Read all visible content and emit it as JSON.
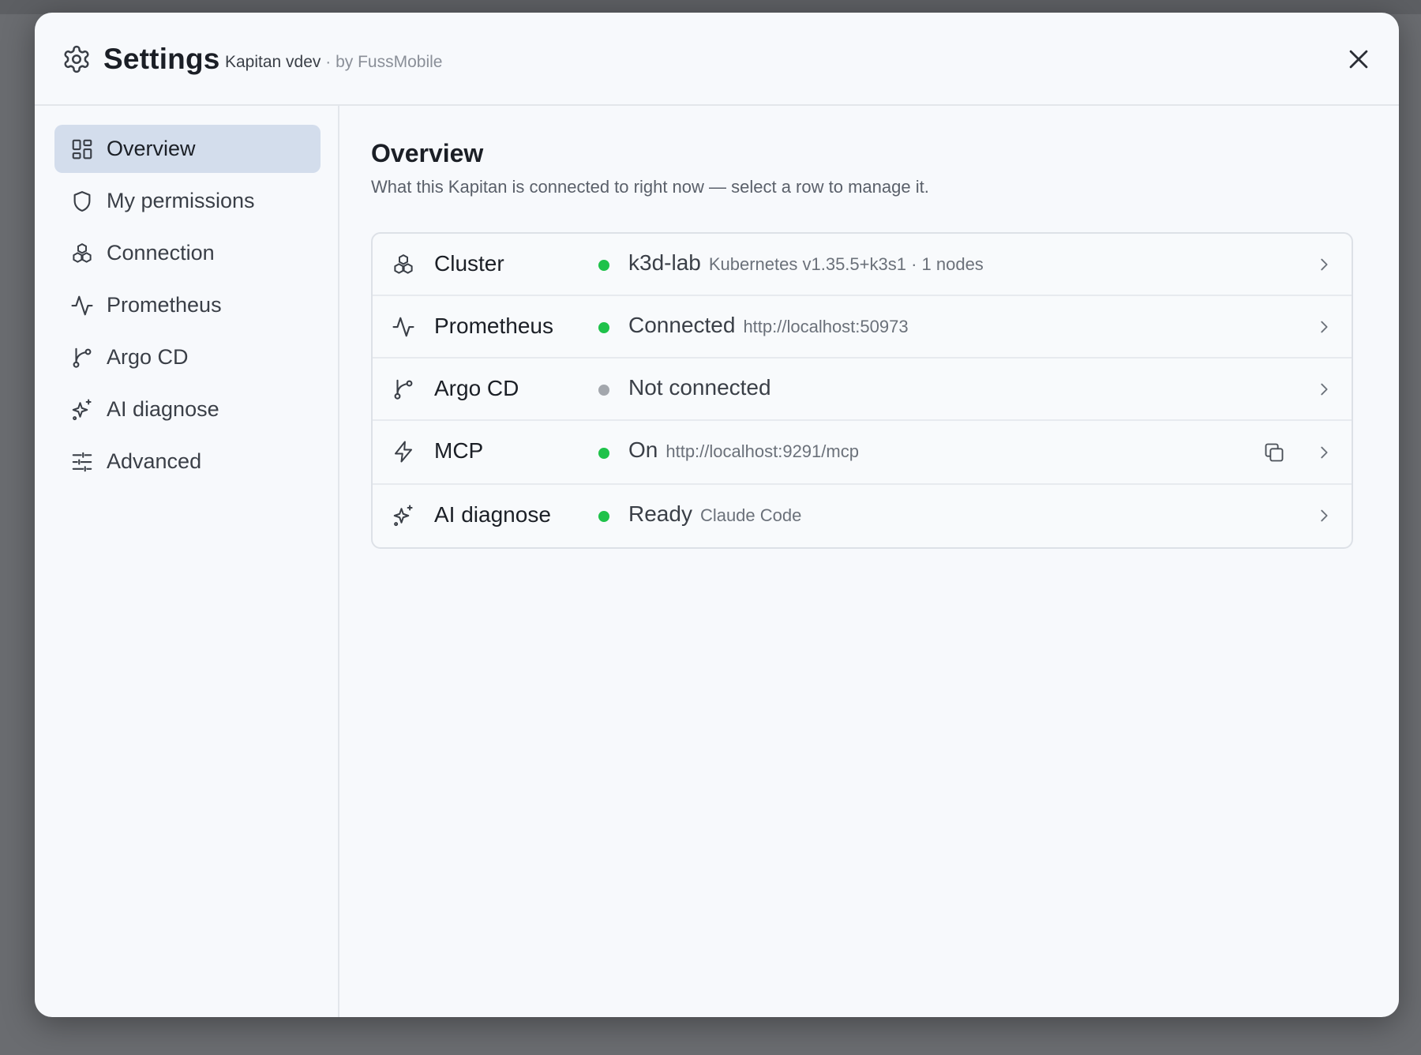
{
  "header": {
    "title": "Settings",
    "app_name": "Kapitan vdev",
    "by_line": "· by FussMobile"
  },
  "sidebar": {
    "items": [
      {
        "label": "Overview",
        "icon": "grid-icon",
        "active": true
      },
      {
        "label": "My permissions",
        "icon": "shield-icon"
      },
      {
        "label": "Connection",
        "icon": "cubes-icon"
      },
      {
        "label": "Prometheus",
        "icon": "pulse-icon"
      },
      {
        "label": "Argo CD",
        "icon": "git-branch-icon"
      },
      {
        "label": "AI diagnose",
        "icon": "sparkles-icon"
      },
      {
        "label": "Advanced",
        "icon": "sliders-icon"
      }
    ]
  },
  "main": {
    "title": "Overview",
    "subtitle": "What this Kapitan is connected to right now — select a row to manage it.",
    "rows": [
      {
        "name": "Cluster",
        "icon": "cubes-icon",
        "status": "k3d-lab",
        "detail": "Kubernetes v1.35.5+k3s1 · 1 nodes",
        "dot": "green"
      },
      {
        "name": "Prometheus",
        "icon": "pulse-icon",
        "status": "Connected",
        "detail": "http://localhost:50973",
        "dot": "green"
      },
      {
        "name": "Argo CD",
        "icon": "git-branch-icon",
        "status": "Not connected",
        "detail": "",
        "dot": "gray"
      },
      {
        "name": "MCP",
        "icon": "zap-icon",
        "status": "On",
        "detail": "http://localhost:9291/mcp",
        "dot": "green",
        "copy": true
      },
      {
        "name": "AI diagnose",
        "icon": "sparkles-icon",
        "status": "Ready",
        "detail": "Claude Code",
        "dot": "green"
      }
    ]
  },
  "colors": {
    "green": "#1fc24a",
    "gray": "#a3a7ad",
    "active_nav": "#d3ddec"
  }
}
